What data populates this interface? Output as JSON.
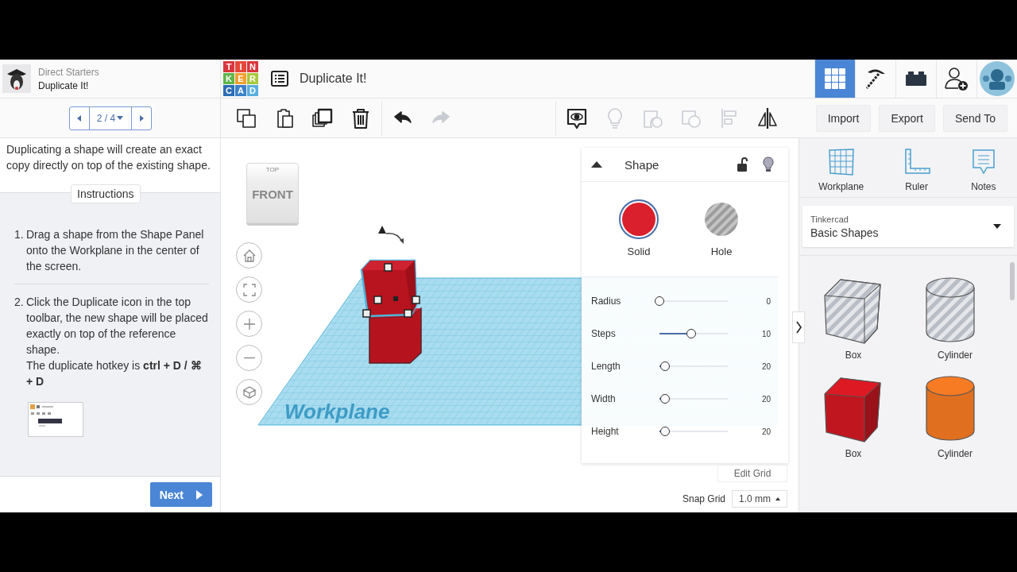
{
  "lesson": {
    "series": "Direct Starters",
    "title": "Duplicate It!",
    "pager": "2 / 4",
    "intro": "Duplicating a shape will create an exact copy directly on top of the existing shape.",
    "section": "Instructions",
    "steps": [
      {
        "number": "1.",
        "text": "Drag a shape from the Shape Panel onto the Workplane in the center of the screen."
      },
      {
        "number": "2.",
        "text": "Click the Duplicate icon in the top toolbar, the new shape will be placed exactly on top of the reference shape.",
        "hotkey": "The duplicate hotkey is **ctrl + D / ⌘ + D**"
      }
    ],
    "next": "Next"
  },
  "logo": [
    {
      "letter": "T",
      "color": "#d9363e"
    },
    {
      "letter": "I",
      "color": "#e5483a"
    },
    {
      "letter": "N",
      "color": "#d9363e"
    },
    {
      "letter": "K",
      "color": "#5fb64a"
    },
    {
      "letter": "E",
      "color": "#f0a030"
    },
    {
      "letter": "R",
      "color": "#a8c83c"
    },
    {
      "letter": "C",
      "color": "#2d6db5"
    },
    {
      "letter": "A",
      "color": "#3c82c8"
    },
    {
      "letter": "D",
      "color": "#5aaee0"
    }
  ],
  "design": {
    "title": "Duplicate It!"
  },
  "top_nav": [
    {
      "kind": "grid",
      "selected": true
    },
    {
      "kind": "pickaxe",
      "selected": false
    },
    {
      "kind": "bricks",
      "selected": false
    },
    {
      "kind": "user-add",
      "selected": false
    },
    {
      "kind": "avatar",
      "selected": false
    }
  ],
  "tools": [
    {
      "kind": "copy",
      "disabled": false
    },
    {
      "kind": "paste",
      "disabled": false
    },
    {
      "kind": "duplicate",
      "disabled": false
    },
    {
      "kind": "delete",
      "disabled": false
    },
    {
      "kind": "undo",
      "disabled": false
    },
    {
      "kind": "redo",
      "disabled": true
    },
    {
      "kind": "notes",
      "disabled": false
    },
    {
      "kind": "bulb",
      "disabled": true
    },
    {
      "kind": "group",
      "disabled": true
    },
    {
      "kind": "ungroup",
      "disabled": true
    },
    {
      "kind": "align",
      "disabled": true
    },
    {
      "kind": "mirror",
      "disabled": false
    }
  ],
  "actions": [
    "Import",
    "Export",
    "Send To"
  ],
  "viewcube": {
    "top": "TOP",
    "front": "FRONT"
  },
  "nav": [
    {
      "kind": "home"
    },
    {
      "kind": "fit"
    },
    {
      "kind": "zoom-in"
    },
    {
      "kind": "zoom-out"
    },
    {
      "kind": "perspective"
    }
  ],
  "workplane": {
    "label": "Workplane"
  },
  "shape_panel": {
    "title": "Shape",
    "modes": [
      {
        "kind": "solid",
        "label": "Solid",
        "selected": true
      },
      {
        "kind": "hole",
        "label": "Hole",
        "selected": false
      }
    ],
    "params": [
      {
        "name": "Radius",
        "level": 0,
        "reading": "0"
      },
      {
        "name": "Steps",
        "level": 0.47,
        "reading": "10"
      },
      {
        "name": "Length",
        "level": 0.08,
        "reading": "20"
      },
      {
        "name": "Width",
        "level": 0.08,
        "reading": "20"
      },
      {
        "name": "Height",
        "level": 0.08,
        "reading": "20"
      }
    ]
  },
  "grid": {
    "edit": "Edit Grid",
    "snap_label": "Snap Grid",
    "snap_value": "1.0 mm"
  },
  "panel_tools": [
    {
      "kind": "workplane",
      "label": "Workplane"
    },
    {
      "kind": "ruler",
      "label": "Ruler"
    },
    {
      "kind": "notes",
      "label": "Notes"
    }
  ],
  "library": {
    "source": "Tinkercad",
    "name": "Basic Shapes"
  },
  "shapes": [
    {
      "kind": "box",
      "hole": true,
      "color": "#b9bdc5",
      "label": "Box"
    },
    {
      "kind": "cylinder",
      "hole": true,
      "color": "#b9bdc5",
      "label": "Cylinder"
    },
    {
      "kind": "box",
      "hole": false,
      "color": "#c0161f",
      "label": "Box"
    },
    {
      "kind": "cylinder",
      "hole": false,
      "color": "#e07020",
      "label": "Cylinder"
    }
  ]
}
